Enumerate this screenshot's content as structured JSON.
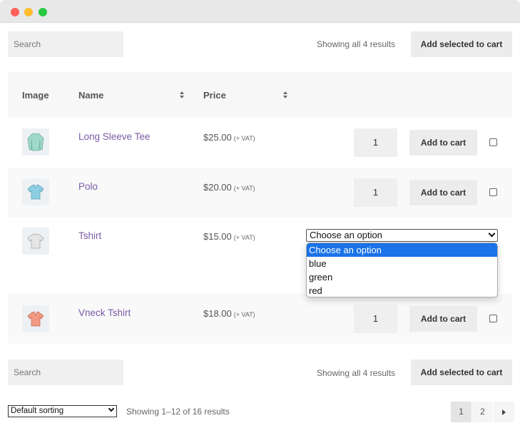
{
  "window": {
    "controls": [
      "close",
      "minimize",
      "maximize"
    ]
  },
  "toolbar_top": {
    "search_placeholder": "Search",
    "results_text": "Showing all 4 results",
    "add_selected_label": "Add selected to cart"
  },
  "table": {
    "headers": {
      "image": "Image",
      "name": "Name",
      "price": "Price"
    },
    "rows": [
      {
        "name": "Long Sleeve Tee",
        "price": "$25.00",
        "vat": "(+ VAT)",
        "qty": "1",
        "add_label": "Add to cart",
        "thumb": "long-sleeve-tee-icon",
        "color": "#9fd9c9"
      },
      {
        "name": "Polo",
        "price": "$20.00",
        "vat": "(+ VAT)",
        "qty": "1",
        "add_label": "Add to cart",
        "thumb": "polo-icon",
        "color": "#8ccfe3"
      },
      {
        "name": "Tshirt",
        "price": "$15.00",
        "vat": "(+ VAT)",
        "variation_select": "Choose an option",
        "options": [
          "Choose an option",
          "blue",
          "green",
          "red"
        ],
        "thumb": "tshirt-icon",
        "color": "#e0e0e0"
      },
      {
        "name": "Vneck Tshirt",
        "price": "$18.00",
        "vat": "(+ VAT)",
        "qty": "1",
        "add_label": "Add to cart",
        "thumb": "vneck-tshirt-icon",
        "color": "#f29a84"
      }
    ]
  },
  "toolbar_bottom": {
    "search_placeholder": "Search",
    "results_text": "Showing all 4 results",
    "add_selected_label": "Add selected to cart"
  },
  "footer": {
    "sorting": "Default sorting",
    "page_info": "Showing 1–12 of 16 results",
    "pages": [
      "1",
      "2"
    ],
    "current_page": "1"
  },
  "colors": {
    "link": "#7a5ba6",
    "button_bg": "#ececec",
    "selected_option": "#1a73e8"
  }
}
